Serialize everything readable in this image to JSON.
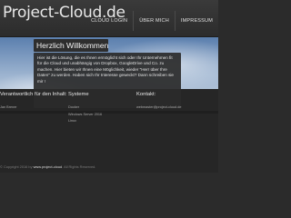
{
  "header": {
    "logo": "Project-Cloud.de",
    "nav": [
      "CLOUD LOGIN",
      "ÜBER MICH",
      "IMPRESSUM"
    ]
  },
  "welcome": {
    "title": "Herzlich Willkommen",
    "text": "Hier ist die Lösung, die es Ihnen ermöglicht sich oder Ihr Unternehmen fit für die Cloud und unabhängig von Dropbox, GoogleDrive und Co. zu machen. Hier bieten wir Ihnen eine Möglichkeit, wieder \"Herr über Ihre Daten\" zu werden. Haben sich Ihr Interesse geweckt? Dann schreiben sie mir !"
  },
  "footer": {
    "columns": [
      {
        "title": "Verantwortlich für den Inhalt:",
        "lines": [
          "Jan Brener"
        ]
      },
      {
        "title": "Systeme",
        "lines": [
          "Docker",
          "Windows Server 2016",
          "Linux"
        ]
      },
      {
        "title": "Kontakt:",
        "lines": [
          "webmaster@project-cloud.de"
        ]
      }
    ],
    "copyright_prefix": "© Copyright 2016 by ",
    "copyright_site": "www.project-cloud",
    "copyright_suffix": ". All Rights Reserved."
  },
  "colors": {
    "background": "#2b2b2b",
    "header": "#333333",
    "box": "#2e2e2e",
    "sky": "#7f9dc2"
  }
}
